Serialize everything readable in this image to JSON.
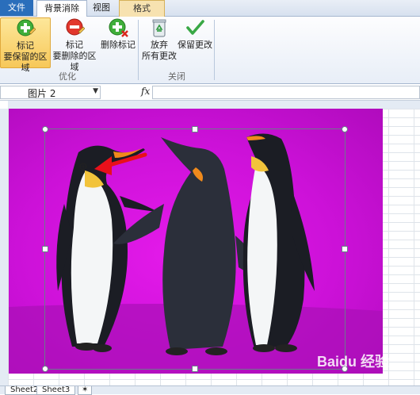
{
  "tabs": {
    "file": "文件",
    "background_removal": "背景消除",
    "view": "视图",
    "format": "格式"
  },
  "ribbon": {
    "mark_keep": {
      "line1": "标记",
      "line2": "要保留的区域"
    },
    "mark_remove": {
      "line1": "标记",
      "line2": "要删除的区域"
    },
    "delete_mark": {
      "line1": "删除标记"
    },
    "discard": {
      "line1": "放弃",
      "line2": "所有更改"
    },
    "keep_changes": {
      "line1": "保留更改"
    },
    "group_refine": "优化",
    "group_close": "关闭"
  },
  "formula_bar": {
    "name_box": "图片 2",
    "fx": "fx",
    "formula": ""
  },
  "sheet_tabs": [
    "Sheet2",
    "Sheet3"
  ],
  "watermark": "Baidu 经验",
  "colors": {
    "picture_background": "#d414de",
    "arrow": "#e8101a",
    "accent_tab": "#2a6ebb"
  }
}
